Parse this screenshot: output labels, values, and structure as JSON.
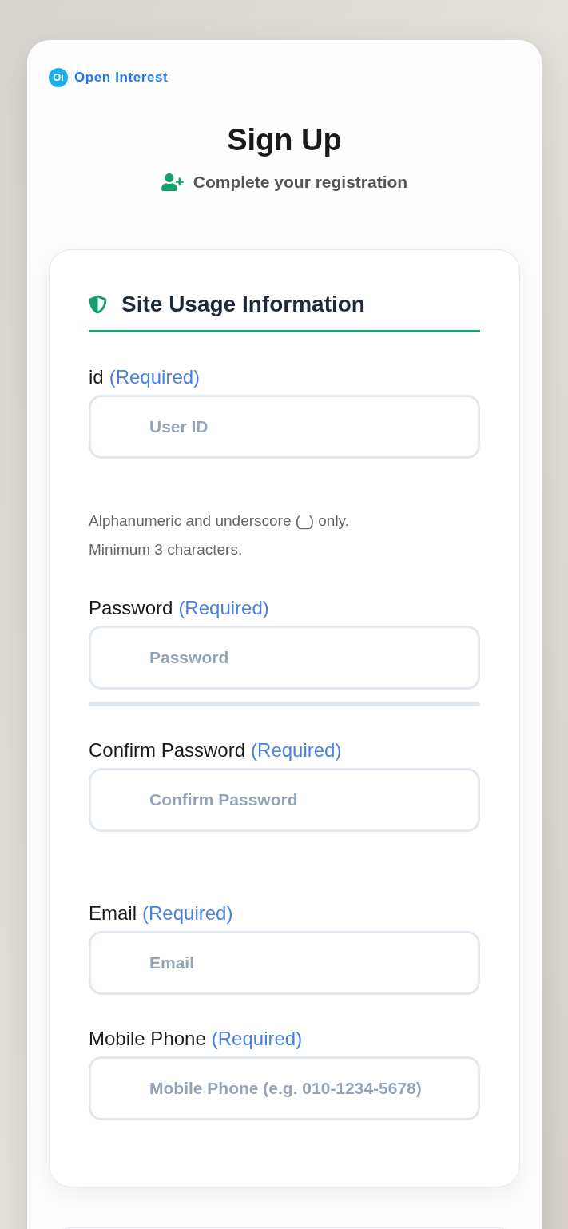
{
  "logo": {
    "mark": "Oi",
    "text": "Open Interest"
  },
  "heading": "Sign Up",
  "subtitle": "Complete your registration",
  "section": {
    "title": "Site Usage Information",
    "fields": [
      {
        "kind": "text",
        "label": "id",
        "required_note": "(Required)",
        "placeholder": "User ID",
        "hints": [
          "Alphanumeric and underscore (_) only.",
          "Minimum 3 characters."
        ]
      },
      {
        "kind": "password",
        "label": "Password",
        "required_note": "(Required)",
        "placeholder": "Password",
        "strength": {
          "level": 0
        }
      },
      {
        "kind": "confirm",
        "label": "Confirm Password",
        "required_note": "(Required)",
        "placeholder": "Confirm Password"
      },
      {
        "kind": "email",
        "label": "Email",
        "required_note": "(Required)",
        "placeholder": "Email"
      },
      {
        "kind": "tel",
        "label": "Mobile Phone",
        "required_note": "(Required)",
        "placeholder": "Mobile Phone (e.g. 010-1234-5678)"
      }
    ]
  }
}
